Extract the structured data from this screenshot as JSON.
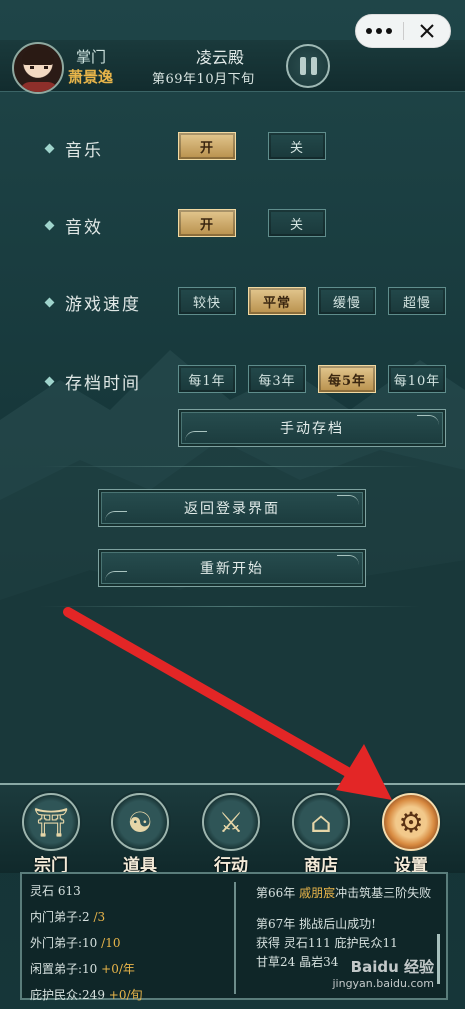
{
  "header": {
    "role": "掌门",
    "name": "萧景逸",
    "sect_title": "凌云殿",
    "date": "第69年10月下旬"
  },
  "settings": {
    "music": {
      "label": "音乐",
      "options": [
        "开",
        "关"
      ],
      "selected": "开"
    },
    "sound": {
      "label": "音效",
      "options": [
        "开",
        "关"
      ],
      "selected": "开"
    },
    "speed": {
      "label": "游戏速度",
      "options": [
        "较快",
        "平常",
        "缓慢",
        "超慢"
      ],
      "selected": "平常"
    },
    "autosave": {
      "label": "存档时间",
      "options": [
        "每1年",
        "每3年",
        "每5年",
        "每10年"
      ],
      "selected": "每5年"
    },
    "manual_save": "手动存档",
    "back_login": "返回登录界面",
    "restart": "重新开始"
  },
  "nav": [
    {
      "label": "宗门",
      "icon": "gate-icon"
    },
    {
      "label": "道具",
      "icon": "bag-icon"
    },
    {
      "label": "行动",
      "icon": "action-icon"
    },
    {
      "label": "商店",
      "icon": "shop-icon"
    },
    {
      "label": "设置",
      "icon": "gear-icon",
      "active": true
    }
  ],
  "stats": {
    "spirit_stone": {
      "label": "灵石",
      "value": "613"
    },
    "inner": {
      "label": "内门弟子:",
      "value": "2",
      "cap": "/3"
    },
    "outer": {
      "label": "外门弟子:",
      "value": "10",
      "cap": "/10"
    },
    "idle": {
      "label": "闲置弟子:",
      "value": "10",
      "rate": "+0/年"
    },
    "people": {
      "label": "庇护民众:",
      "value": "249",
      "rate": "+0/旬"
    }
  },
  "log": {
    "e1_prefix": "第66年",
    "e1_name": "戚朋宸",
    "e1_text": "冲击筑基三阶失败",
    "e2_line1": "第67年 挑战后山成功!",
    "e2_line2": "获得 灵石111 庇护民众11",
    "e2_line3": "甘草24 晶岩34"
  },
  "watermark": {
    "brand": "Baidu 经验",
    "url": "jingyan.baidu.com"
  },
  "colors": {
    "accent_gold": "#e8b54a",
    "selected_option": "#d8b673",
    "arrow_red": "#e32626"
  }
}
